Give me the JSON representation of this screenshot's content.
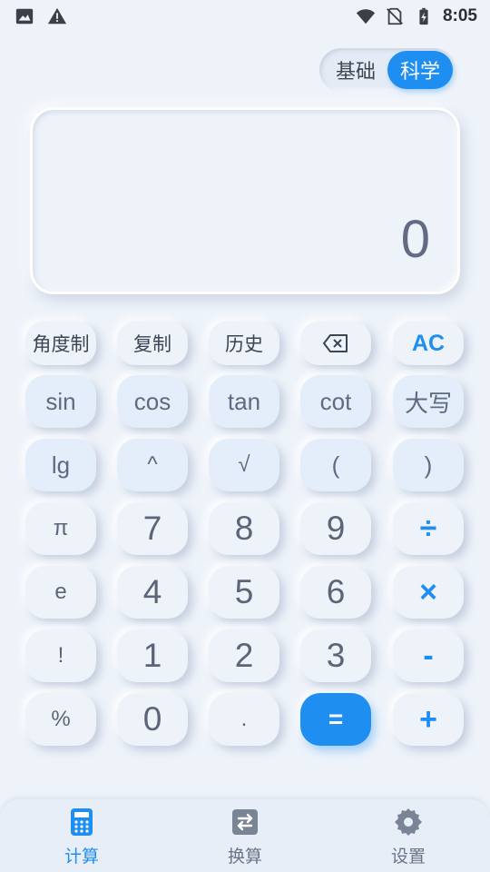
{
  "status_bar": {
    "time": "8:05",
    "icons": [
      "image-icon",
      "warning-icon",
      "wifi-icon",
      "no-sim-icon",
      "battery-charging-icon"
    ]
  },
  "mode_toggle": {
    "basic": "基础",
    "scientific": "科学",
    "selected": "科学"
  },
  "display": {
    "value": "0"
  },
  "keypad": {
    "row1": [
      "角度制",
      "复制",
      "历史",
      "backspace-icon",
      "AC"
    ],
    "row2": [
      "sin",
      "cos",
      "tan",
      "cot",
      "大写"
    ],
    "row3": [
      "lg",
      "^",
      "√",
      "(",
      ")"
    ],
    "row4": [
      "π",
      "7",
      "8",
      "9",
      "÷"
    ],
    "row5": [
      "e",
      "4",
      "5",
      "6",
      "×"
    ],
    "row6": [
      "!",
      "1",
      "2",
      "3",
      "-"
    ],
    "row7": [
      "%",
      "0",
      ".",
      "=",
      "+"
    ]
  },
  "bottom_nav": {
    "items": [
      {
        "label": "计算",
        "icon": "calculator-icon",
        "active": true
      },
      {
        "label": "换算",
        "icon": "exchange-icon",
        "active": false
      },
      {
        "label": "设置",
        "icon": "gear-icon",
        "active": false
      }
    ]
  },
  "colors": {
    "accent": "#1e8ef0",
    "background": "#eef3fa",
    "function_key": "#e4eefb"
  }
}
